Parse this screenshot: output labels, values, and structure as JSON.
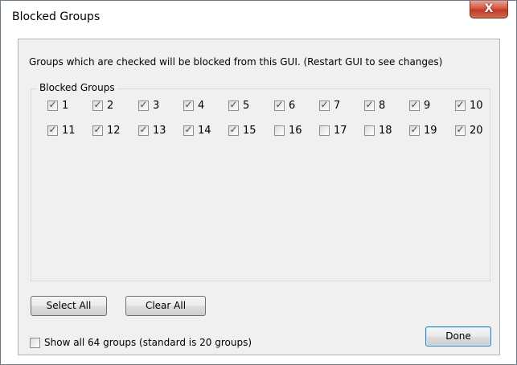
{
  "window": {
    "title": "Blocked Groups",
    "close_glyph": "X"
  },
  "description": "Groups which are checked will be blocked from this GUI.  (Restart GUI to see changes)",
  "groupbox": {
    "label": "Blocked Groups"
  },
  "groups": [
    {
      "label": "1",
      "checked": true
    },
    {
      "label": "2",
      "checked": true
    },
    {
      "label": "3",
      "checked": true
    },
    {
      "label": "4",
      "checked": true
    },
    {
      "label": "5",
      "checked": true
    },
    {
      "label": "6",
      "checked": true
    },
    {
      "label": "7",
      "checked": true
    },
    {
      "label": "8",
      "checked": true
    },
    {
      "label": "9",
      "checked": true
    },
    {
      "label": "10",
      "checked": true
    },
    {
      "label": "11",
      "checked": true
    },
    {
      "label": "12",
      "checked": true
    },
    {
      "label": "13",
      "checked": true
    },
    {
      "label": "14",
      "checked": true
    },
    {
      "label": "15",
      "checked": true
    },
    {
      "label": "16",
      "checked": false
    },
    {
      "label": "17",
      "checked": false
    },
    {
      "label": "18",
      "checked": false
    },
    {
      "label": "19",
      "checked": true
    },
    {
      "label": "20",
      "checked": true
    }
  ],
  "buttons": {
    "select_all": "Select All",
    "clear_all": "Clear All",
    "done": "Done"
  },
  "show_all": {
    "label": "Show all 64 groups (standard is 20 groups)",
    "checked": false
  }
}
